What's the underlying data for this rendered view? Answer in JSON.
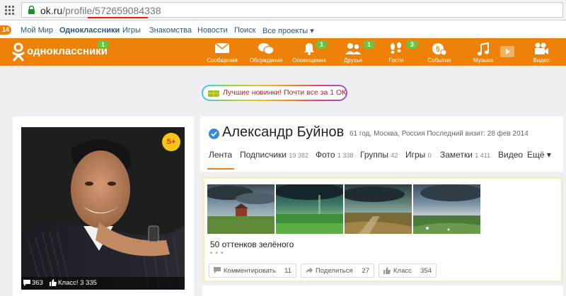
{
  "browser": {
    "url_domain": "ok.ru",
    "url_path": "/profile/",
    "url_id": "572659084338"
  },
  "portal": {
    "badge": "14",
    "links": [
      "Мой Мир",
      "Одноклассники",
      "Игры",
      "Знакомства",
      "Новости",
      "Поиск",
      "Все проекты ▾"
    ]
  },
  "header": {
    "logo_text": "одноклассники",
    "logo_badge": "1",
    "nav": [
      {
        "label": "Сообщения",
        "icon": "envelope-icon"
      },
      {
        "label": "Обсуждения",
        "icon": "chat-bubbles-icon"
      },
      {
        "label": "Оповещения",
        "icon": "bell-icon",
        "badge": "1"
      },
      {
        "label": "Друзья",
        "icon": "friends-icon",
        "badge": "1"
      },
      {
        "label": "Гости",
        "icon": "footprints-icon",
        "badge": "3"
      },
      {
        "label": "События",
        "icon": "events-icon"
      },
      {
        "label": "Музыка",
        "icon": "music-note-icon"
      },
      {
        "label": "Видео",
        "icon": "video-camera-icon"
      }
    ]
  },
  "promo": {
    "text": "Лучшие новинки! Почти все за 1 ОК"
  },
  "avatar": {
    "age_badge": "5+",
    "comments": "363",
    "klass": "Класс! 3 335"
  },
  "profile": {
    "name": "Александр Буйнов",
    "meta": "61 год, Москва, Россия  Последний визит: 28 фев 2014",
    "tabs": [
      {
        "label": "Лента",
        "count": ""
      },
      {
        "label": "Подписчики",
        "count": "19 382"
      },
      {
        "label": "Фото",
        "count": "1 338"
      },
      {
        "label": "Группы",
        "count": "42"
      },
      {
        "label": "Игры",
        "count": "0"
      },
      {
        "label": "Заметки",
        "count": "1 411"
      },
      {
        "label": "Видео",
        "count": ""
      },
      {
        "label": "Ещё ▾",
        "count": ""
      }
    ]
  },
  "feed": {
    "title": "50 оттенков зелёного",
    "dots": "• • •",
    "actions": [
      {
        "label": "Комментировать",
        "count": "11",
        "icon": "comment-icon"
      },
      {
        "label": "Поделиться",
        "count": "27",
        "icon": "share-icon"
      },
      {
        "label": "Класс",
        "count": "354",
        "icon": "thumbs-up-icon"
      }
    ]
  },
  "colors": {
    "brand_orange": "#ee8208",
    "badge_green": "#6cc33f",
    "link_blue": "#2a5885",
    "promo_red": "#c41e1e"
  }
}
